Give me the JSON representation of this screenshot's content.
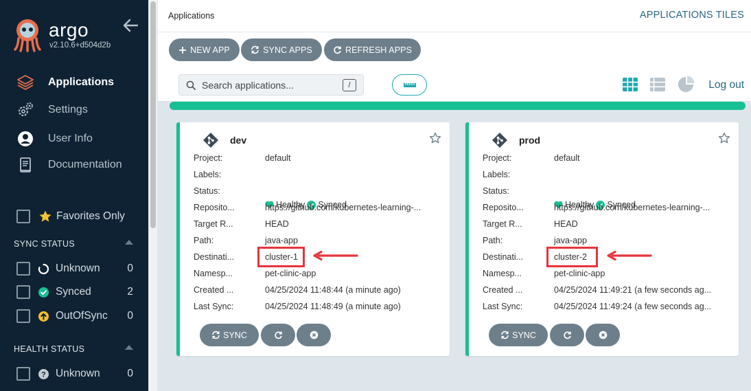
{
  "sidebar": {
    "brand": "argo",
    "version": "v2.10.6+d504d2b",
    "nav": [
      {
        "label": "Applications",
        "icon": "layers-icon",
        "active": true
      },
      {
        "label": "Settings",
        "icon": "gears-icon"
      },
      {
        "label": "User Info",
        "icon": "user-icon"
      },
      {
        "label": "Documentation",
        "icon": "book-icon"
      }
    ],
    "favorites_label": "Favorites Only",
    "sync_status": {
      "title": "SYNC STATUS",
      "items": [
        {
          "label": "Unknown",
          "count": "0",
          "icon": "circle-notch-icon"
        },
        {
          "label": "Synced",
          "count": "2",
          "icon": "check-circle-icon"
        },
        {
          "label": "OutOfSync",
          "count": "0",
          "icon": "arrow-up-circle-icon"
        }
      ]
    },
    "health_status": {
      "title": "HEALTH STATUS",
      "items": [
        {
          "label": "Unknown",
          "count": "0",
          "icon": "question-circle-icon"
        }
      ]
    }
  },
  "header": {
    "title": "Applications",
    "view_title": "APPLICATIONS TILES"
  },
  "toolbar": {
    "new_app": "NEW APP",
    "sync_apps": "SYNC APPS",
    "refresh_apps": "REFRESH APPS",
    "search_placeholder": "Search applications...",
    "search_shortcut": "/",
    "logout": "Log out"
  },
  "progress": {
    "fraction": 1.0
  },
  "colors": {
    "healthy": "#18be94",
    "sidebar": "#0e2233",
    "accent": "#2a6680",
    "highlight": "#e8343b"
  },
  "labels": {
    "project": "Project:",
    "labels": "Labels:",
    "status": "Status:",
    "repository": "Reposito...",
    "target": "Target R...",
    "path": "Path:",
    "destination": "Destinati...",
    "namespace": "Namesp...",
    "created": "Created ...",
    "last_sync": "Last Sync:"
  },
  "apps": [
    {
      "name": "dev",
      "project": "default",
      "labels": "",
      "health": "Healthy",
      "sync": "Synced",
      "repository": "https://github.com/kubernetes-learning-...",
      "target": "HEAD",
      "path": "java-app",
      "destination": "cluster-1",
      "namespace": "pet-clinic-app",
      "created": "04/25/2024 11:48:44  (a minute ago)",
      "last_sync": "04/25/2024 11:48:49  (a minute ago)",
      "sync_button": "SYNC"
    },
    {
      "name": "prod",
      "project": "default",
      "labels": "",
      "health": "Healthy",
      "sync": "Synced",
      "repository": "https://github.com/kubernetes-learning-...",
      "target": "HEAD",
      "path": "java-app",
      "destination": "cluster-2",
      "namespace": "pet-clinic-app",
      "created": "04/25/2024 11:49:21  (a few seconds ag...",
      "last_sync": "04/25/2024 11:49:24  (a few seconds ag...",
      "sync_button": "SYNC"
    }
  ]
}
